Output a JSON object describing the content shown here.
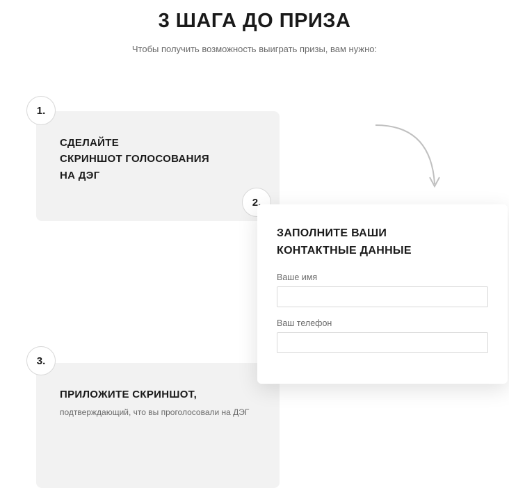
{
  "title": "3 ШАГА ДО ПРИЗА",
  "subtitle": "Чтобы получить возможность выиграть призы, вам нужно:",
  "steps": {
    "s1": {
      "badge": "1.",
      "title_l1": "СДЕЛАЙТЕ",
      "title_l2": "СКРИНШОТ ГОЛОСОВАНИЯ",
      "title_l3": "НА ДЭГ"
    },
    "s2": {
      "badge": "2.",
      "title_l1": "ЗАПОЛНИТЕ ВАШИ",
      "title_l2": "КОНТАКТНЫЕ ДАННЫЕ",
      "name_label": "Ваше имя",
      "phone_label": "Ваш телефон"
    },
    "s3": {
      "badge": "3.",
      "title": "ПРИЛОЖИТЕ СКРИНШОТ,",
      "subtext": "подтверждающий, что вы проголосовали на ДЭГ"
    }
  }
}
